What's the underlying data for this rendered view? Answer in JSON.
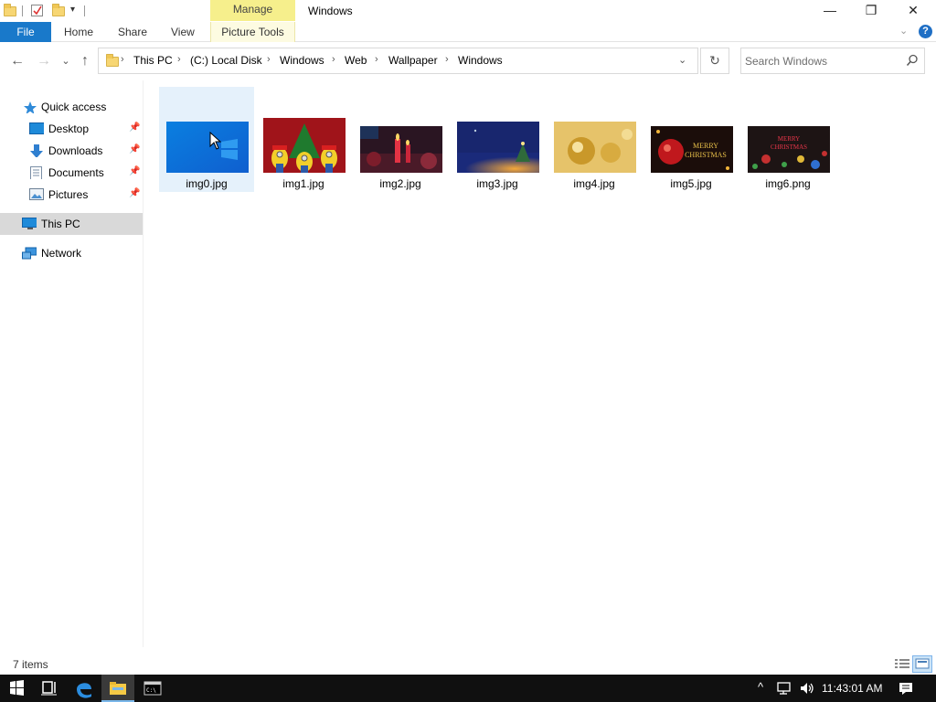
{
  "titlebar": {
    "window_title": "Windows",
    "contextual_tab": "Manage",
    "minimize_glyph": "—",
    "maximize_glyph": "❐",
    "close_glyph": "✕"
  },
  "ribbon": {
    "file_tab": "File",
    "tabs": [
      "Home",
      "Share",
      "View"
    ],
    "contextual_group": "Picture Tools",
    "expand_glyph": "⌄",
    "help_glyph": "?"
  },
  "navbar": {
    "back_glyph": "←",
    "forward_glyph": "→",
    "recent_glyph": "⌄",
    "up_glyph": "↑",
    "breadcrumb": [
      "This PC",
      "(C:) Local Disk",
      "Windows",
      "Web",
      "Wallpaper",
      "Windows"
    ],
    "crumb_separator": "›",
    "dropdown_glyph": "⌄",
    "refresh_glyph": "↻",
    "search_placeholder": "Search Windows"
  },
  "nav_pane": {
    "quick_access": "Quick access",
    "pinned": [
      "Desktop",
      "Downloads",
      "Documents",
      "Pictures"
    ],
    "pin_glyph": "📌",
    "this_pc": "This PC",
    "network": "Network"
  },
  "files": [
    {
      "name": "img0.jpg",
      "selected": true
    },
    {
      "name": "img1.jpg"
    },
    {
      "name": "img2.jpg"
    },
    {
      "name": "img3.jpg"
    },
    {
      "name": "img4.jpg"
    },
    {
      "name": "img5.jpg"
    },
    {
      "name": "img6.png"
    }
  ],
  "thumb_texts": {
    "img5": "MERRY\nCHRISTMAS",
    "img6": "MERRY\nCHRISTMAS"
  },
  "status": {
    "item_count": "7 items"
  },
  "taskbar": {
    "clock": "11:43:01 AM",
    "tray_up": "^"
  },
  "colors": {
    "accent": "#1979ca",
    "selection": "#e5f1fb",
    "manage_tab": "#f6ef8c",
    "taskbar": "#101010"
  }
}
